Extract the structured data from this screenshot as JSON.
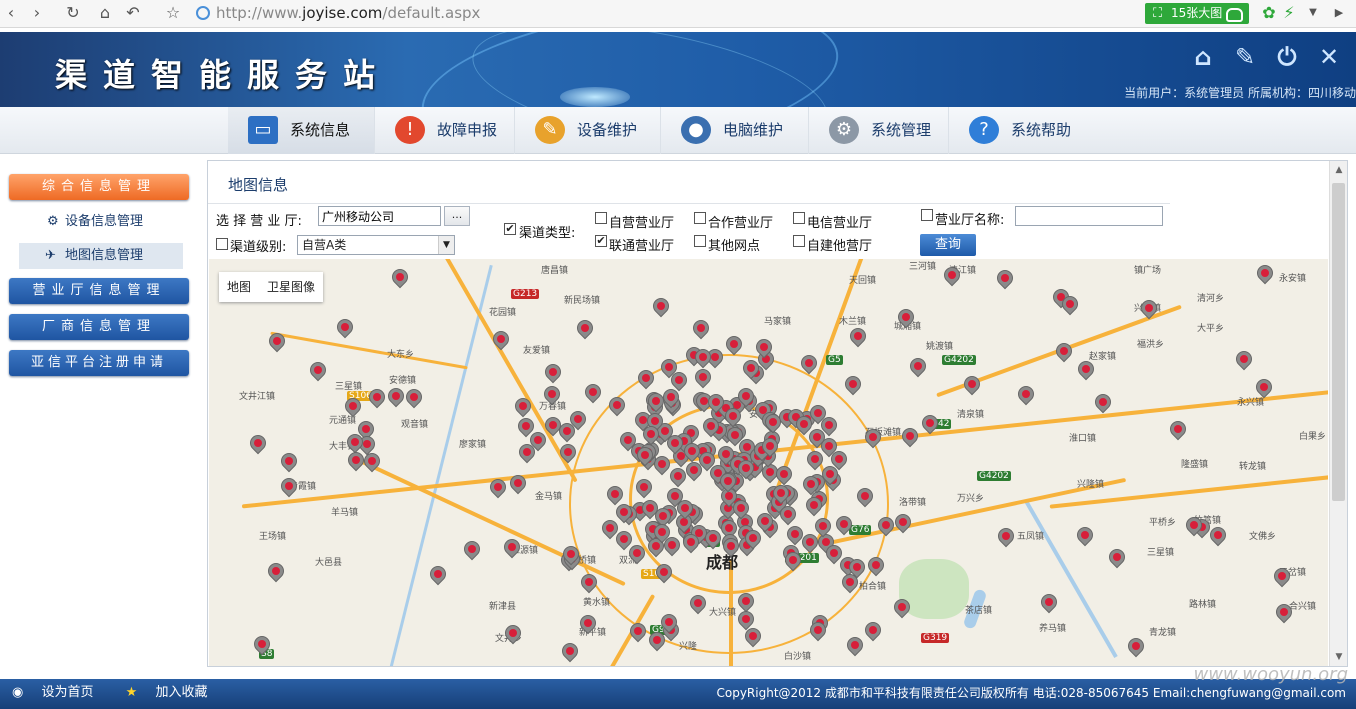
{
  "browser": {
    "url_prefix": "http://www.",
    "url_domain": "joyise.com",
    "url_path": "/default.aspx",
    "big_image_label": "15张大图"
  },
  "header": {
    "site_title": "渠道智能服务站",
    "current_user": "当前用户：系统管理员 所属机构：四川移动"
  },
  "nav": {
    "items": [
      {
        "label": "系统信息",
        "icon": "monitor-icon"
      },
      {
        "label": "故障申报",
        "icon": "warning-icon"
      },
      {
        "label": "设备维护",
        "icon": "wrench-icon"
      },
      {
        "label": "电脑维护",
        "icon": "user-icon"
      },
      {
        "label": "系统管理",
        "icon": "gear-icon"
      },
      {
        "label": "系统帮助",
        "icon": "help-icon"
      }
    ]
  },
  "sidebar": {
    "main_button": "综合信息管理",
    "sub_items": [
      "设备信息管理",
      "地图信息管理"
    ],
    "buttons": [
      "营业厅信息管理",
      "厂商信息管理",
      "亚信平台注册申请"
    ]
  },
  "panel": {
    "title": "地图信息",
    "select_hall_label": "选 择 营 业 厅:",
    "select_hall_value": "广州移动公司",
    "browse_label": "...",
    "channel_type_label": "渠道类型:",
    "channel_level_label": "渠道级别:",
    "channel_level_value": "自营A类",
    "types": [
      {
        "label": "自营营业厅",
        "checked": false
      },
      {
        "label": "合作营业厅",
        "checked": false
      },
      {
        "label": "电信营业厅",
        "checked": false
      },
      {
        "label": "联通营业厅",
        "checked": true
      },
      {
        "label": "其他网点",
        "checked": false
      },
      {
        "label": "自建他营厅",
        "checked": false
      }
    ],
    "hall_name_label": "营业厅名称:",
    "query_label": "查询",
    "check_mark": "✔"
  },
  "map": {
    "tabs": [
      "地图",
      "卫星图像"
    ],
    "city_label": "成都",
    "places": [
      "唐昌镇",
      "新民场镇",
      "天回镇",
      "三河镇",
      "清江镇",
      "镇广场",
      "永安镇",
      "花园镇",
      "马家镇",
      "木兰镇",
      "清河乡",
      "大平乡",
      "兴隆镇",
      "大东乡",
      "友爱镇",
      "城厢镇",
      "福洪乡",
      "文井江镇",
      "安德镇",
      "姚渡镇",
      "赵家镇",
      "永兴镇",
      "三星镇",
      "元通镇",
      "万春镇",
      "大丰镇",
      "清泉镇",
      "石板滩镇",
      "淮口镇",
      "隆盛镇",
      "转龙镇",
      "白果乡",
      "观音镇",
      "廖家镇",
      "金马镇",
      "安靖镇",
      "万兴乡",
      "兴隆镇",
      "竹篙镇",
      "青霞镇",
      "洛带镇",
      "五凤镇",
      "文佛乡",
      "羊马镇",
      "江源镇",
      "双流",
      "金桥镇",
      "柏合镇",
      "平桥乡",
      "三星镇",
      "三岔镇",
      "王场镇",
      "大邑县",
      "黄水镇",
      "茶店镇",
      "路林镇",
      "大兴镇",
      "新津县",
      "新平镇",
      "白沙镇",
      "青龙镇",
      "养马镇",
      "兴隆",
      "文井乡",
      "合兴镇"
    ],
    "road_tags": [
      "G213",
      "G5",
      "G4202",
      "S106",
      "G42",
      "G4201",
      "G76",
      "S103",
      "S6",
      "G93",
      "G319",
      "S8",
      "G4202"
    ]
  },
  "footer": {
    "set_home": "设为首页",
    "add_fav": "加入收藏",
    "copyright": "CopyRight@2012 成都市和平科技有限责任公司版权所有 电话:028-85067645 Email:chengfuwang@gmail.com"
  },
  "watermark": "www.wooyun.org"
}
